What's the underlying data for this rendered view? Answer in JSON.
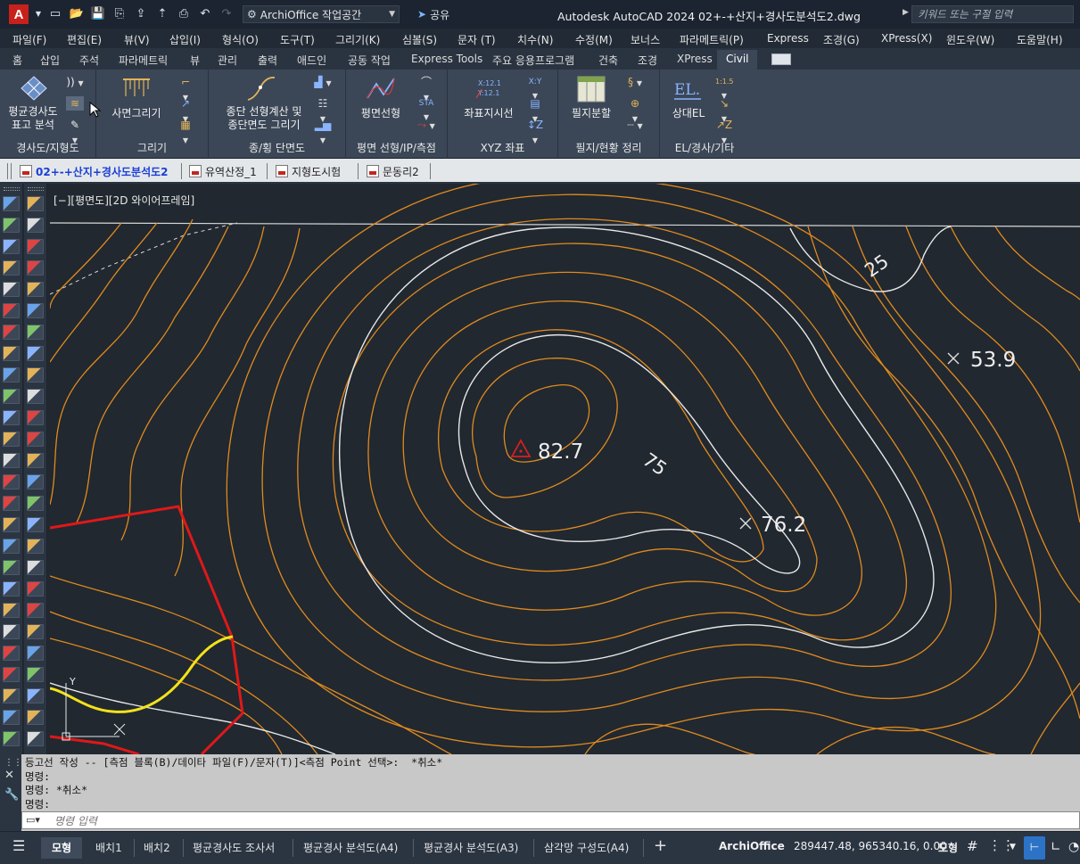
{
  "titlebar": {
    "app_letter": "A",
    "workspace": "ArchiOffice 작업공간",
    "share": "공유",
    "title": "Autodesk AutoCAD 2024    02+-+산지+경사도분석도2.dwg",
    "search_placeholder": "키워드 또는 구절 입력"
  },
  "menu": [
    "파일(F)",
    "편집(E)",
    "뷰(V)",
    "삽입(I)",
    "형식(O)",
    "도구(T)",
    "그리기(K)",
    "심볼(S)",
    "문자 (T)",
    "치수(N)",
    "수정(M)",
    "보너스",
    "파라메트릭(P)",
    "Express",
    "조경(G)",
    "XPress(X)",
    "윈도우(W)",
    "도움말(H)"
  ],
  "ribbon_tabs": [
    "홈",
    "삽입",
    "주석",
    "파라메트릭",
    "뷰",
    "관리",
    "출력",
    "애드인",
    "공동 작업",
    "Express Tools",
    "주요 응용프로그램",
    "건축",
    "조경",
    "XPress",
    "Civil"
  ],
  "ribbon_active_tab": "Civil",
  "ribbon": {
    "g1": {
      "btn_line1": "평균경사도",
      "btn_line2": "표고 분석",
      "label": "경사도/지형도"
    },
    "g2": {
      "btn": "사면그리기",
      "label": "그리기"
    },
    "g3": {
      "btn_line1": "종단 선형계산 및",
      "btn_line2": "종단면도 그리기",
      "label": "종/횡 단면도"
    },
    "g4": {
      "btn": "평면선형",
      "label": "평면 선형/IP/측점"
    },
    "g5": {
      "btn": "좌표지시선",
      "label": "XYZ 좌표"
    },
    "g6": {
      "btn": "필지분할",
      "label": "필지/현황 정리"
    },
    "g7": {
      "btn": "상대EL",
      "label": "EL/경사/기타"
    }
  },
  "doc_tabs": [
    "02+-+산지+경사도분석도2",
    "유역산정_1",
    "지형도시험",
    "문동리2"
  ],
  "viewport": {
    "label": "[−][평면도][2D 와이어프레임]",
    "annotations": {
      "peak": "82.7",
      "contour_75": "75",
      "contour_25": "25",
      "point_a": "76.2",
      "point_b": "53.9"
    }
  },
  "command": {
    "history": [
      "등고선 작성 -- [측점 블록(B)/데이타 파일(F)/문자(T)]<측점 Point 선택>:  *취소*",
      "명령:",
      "명령: *취소*",
      "명령:"
    ],
    "placeholder": "명령 입력"
  },
  "status": {
    "tabs": [
      "모형",
      "배치1",
      "배치2",
      "평균경사도 조사서",
      "평균경사 분석도(A4)",
      "평균경사 분석도(A3)",
      "삼각망 구성도(A4)"
    ],
    "app": "ArchiOffice",
    "coords": "289447.48, 965340.16, 0.00",
    "mode": "모형"
  },
  "colors": {
    "contour_major": "#e8e8e8",
    "contour_minor": "#e08a1e",
    "boundary": "#e01818",
    "highlight": "#f2e21a",
    "background": "#212830"
  }
}
